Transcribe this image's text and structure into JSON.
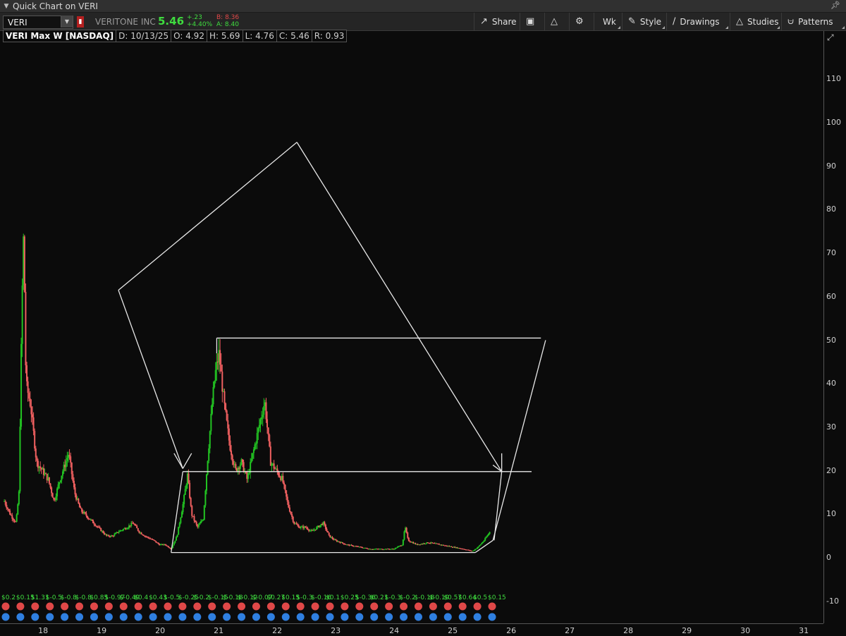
{
  "window": {
    "title": "Quick Chart on VERI"
  },
  "toolbar": {
    "symbol": "VERI",
    "company": "VERITONE INC",
    "last": "5.46",
    "change": "+.23",
    "change_pct": "+4.40%",
    "bid": "B: 8.36",
    "ask": "A: 8.40",
    "buttons": {
      "share": "Share",
      "period": "Wk",
      "style": "Style",
      "drawings": "Drawings",
      "studies": "Studies",
      "patterns": "Patterns"
    }
  },
  "info": {
    "title": "VERI Max W [NASDAQ]",
    "date": "D: 10/13/25",
    "open": "O: 4.92",
    "high": "H: 5.69",
    "low": "L: 4.76",
    "close": "C: 5.46",
    "range": "R: 0.93"
  },
  "colors": {
    "up": "#22c322",
    "down": "#f06060",
    "drawing": "#e8e8e8",
    "earnings_green": "#3fdc3f",
    "earnings_red": "#e04848",
    "div_blue": "#2f7fe0"
  },
  "chart_data": {
    "type": "line",
    "title": "VERI Max W [NASDAQ]",
    "xlabel": "",
    "ylabel": "",
    "x_ticks": [
      "18",
      "19",
      "20",
      "21",
      "22",
      "23",
      "24",
      "25",
      "26",
      "27",
      "28",
      "29",
      "30",
      "31"
    ],
    "y_ticks": [
      110,
      100,
      90,
      80,
      70,
      60,
      50,
      40,
      30,
      20,
      10,
      0,
      -10
    ],
    "ylim": [
      -10,
      116
    ],
    "xlim": [
      17.3,
      31.3
    ],
    "series": [
      {
        "values": [
          [
            17.35,
            13
          ],
          [
            17.45,
            10
          ],
          [
            17.55,
            8
          ],
          [
            17.6,
            15
          ],
          [
            17.65,
            58
          ],
          [
            17.68,
            75
          ],
          [
            17.72,
            40
          ],
          [
            17.8,
            35
          ],
          [
            17.9,
            22
          ],
          [
            18.0,
            20
          ],
          [
            18.1,
            18
          ],
          [
            18.2,
            13
          ],
          [
            18.3,
            18
          ],
          [
            18.4,
            22
          ],
          [
            18.45,
            24
          ],
          [
            18.55,
            15
          ],
          [
            18.65,
            11
          ],
          [
            18.8,
            9
          ],
          [
            18.95,
            7
          ],
          [
            19.1,
            5
          ],
          [
            19.2,
            5
          ],
          [
            19.3,
            6
          ],
          [
            19.45,
            7
          ],
          [
            19.55,
            8
          ],
          [
            19.65,
            6
          ],
          [
            19.75,
            5
          ],
          [
            19.9,
            4
          ],
          [
            20.0,
            3
          ],
          [
            20.1,
            3
          ],
          [
            20.2,
            2
          ],
          [
            20.3,
            5
          ],
          [
            20.4,
            12
          ],
          [
            20.48,
            19
          ],
          [
            20.55,
            10
          ],
          [
            20.65,
            7
          ],
          [
            20.75,
            9
          ],
          [
            20.82,
            22
          ],
          [
            20.9,
            35
          ],
          [
            20.95,
            42
          ],
          [
            21.02,
            47
          ],
          [
            21.1,
            36
          ],
          [
            21.2,
            26
          ],
          [
            21.3,
            20
          ],
          [
            21.4,
            22
          ],
          [
            21.5,
            18
          ],
          [
            21.6,
            24
          ],
          [
            21.7,
            30
          ],
          [
            21.8,
            36
          ],
          [
            21.9,
            22
          ],
          [
            22.0,
            20
          ],
          [
            22.1,
            18
          ],
          [
            22.2,
            12
          ],
          [
            22.3,
            8
          ],
          [
            22.4,
            7
          ],
          [
            22.5,
            7
          ],
          [
            22.6,
            6
          ],
          [
            22.7,
            7
          ],
          [
            22.8,
            8
          ],
          [
            22.9,
            5
          ],
          [
            23.0,
            4
          ],
          [
            23.2,
            3
          ],
          [
            23.4,
            2.5
          ],
          [
            23.6,
            2
          ],
          [
            23.8,
            2
          ],
          [
            24.0,
            2
          ],
          [
            24.15,
            3
          ],
          [
            24.2,
            7
          ],
          [
            24.25,
            4
          ],
          [
            24.4,
            3
          ],
          [
            24.6,
            3.5
          ],
          [
            24.8,
            3
          ],
          [
            25.0,
            2.5
          ],
          [
            25.2,
            2
          ],
          [
            25.35,
            1.5
          ],
          [
            25.45,
            2.5
          ],
          [
            25.55,
            4
          ],
          [
            25.65,
            6
          ]
        ]
      }
    ],
    "event_row_labels": [
      "$0.2",
      "$0.15",
      "$1.31",
      "$-0.5",
      "$-0.8",
      "$-0.8",
      "$0.85",
      "$-0.97",
      "$-0.49",
      "$0.4",
      "$0.43",
      "$-0.5",
      "$-0.25",
      "$-0.2",
      "$-0.15",
      "$-0.18",
      "$-0.12",
      "$-0.07",
      "$0.27",
      "$0.15",
      "$-0.3",
      "$-0.16",
      "$0.1",
      "$0.25",
      "$-0.36",
      "$0.21",
      "$-0.3",
      "$-0.2",
      "$-0.18",
      "$-0.19",
      "$0.57",
      "$0.64",
      "$0.5",
      "$0.15"
    ]
  }
}
